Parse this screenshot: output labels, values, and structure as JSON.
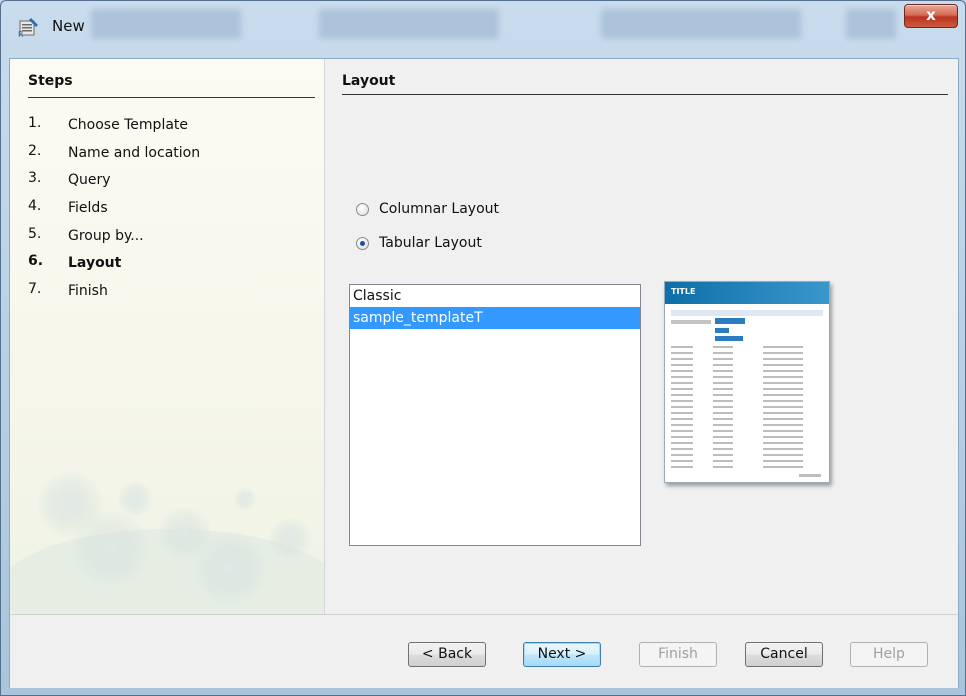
{
  "window": {
    "title": "New",
    "close_label": "x"
  },
  "steps": {
    "title": "Steps",
    "items": [
      {
        "num": "1.",
        "label": "Choose Template"
      },
      {
        "num": "2.",
        "label": "Name and location"
      },
      {
        "num": "3.",
        "label": "Query"
      },
      {
        "num": "4.",
        "label": "Fields"
      },
      {
        "num": "5.",
        "label": "Group by..."
      },
      {
        "num": "6.",
        "label": "Layout",
        "current": true
      },
      {
        "num": "7.",
        "label": "Finish"
      }
    ]
  },
  "layout": {
    "title": "Layout",
    "options": [
      {
        "label": "Columnar Layout",
        "selected": false
      },
      {
        "label": "Tabular Layout",
        "selected": true
      }
    ],
    "templates": [
      {
        "label": "Classic",
        "selected": false
      },
      {
        "label": "sample_templateT",
        "selected": true
      }
    ],
    "preview": {
      "title": "TITLE"
    }
  },
  "buttons": {
    "back": "< Back",
    "next": "Next >",
    "finish": "Finish",
    "cancel": "Cancel",
    "help": "Help"
  }
}
